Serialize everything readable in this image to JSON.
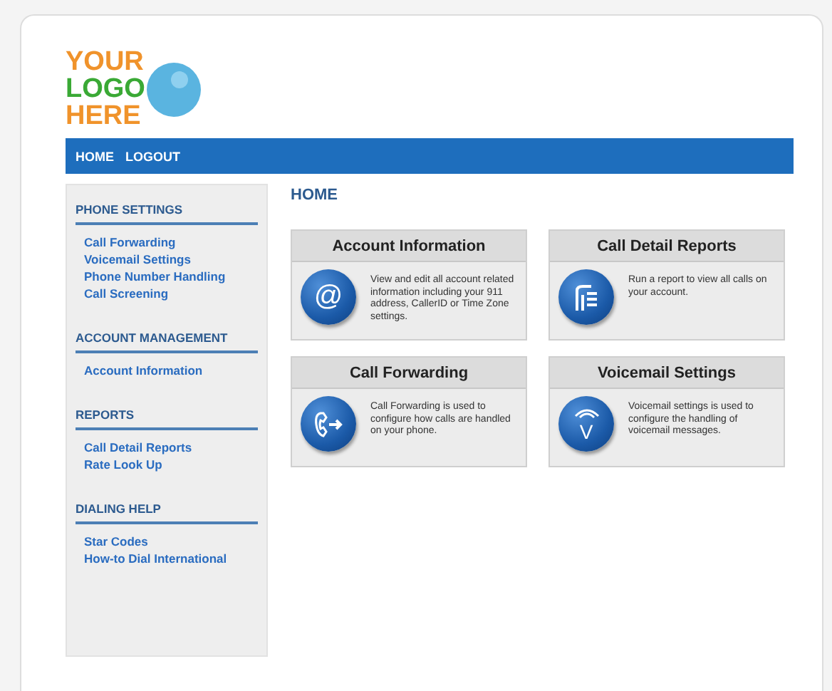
{
  "logo": {
    "lines": [
      "YOUR",
      "LOGO",
      "HERE"
    ]
  },
  "nav": [
    {
      "label": "HOME"
    },
    {
      "label": "LOGOUT"
    }
  ],
  "sidebar": [
    {
      "heading": "PHONE SETTINGS",
      "links": [
        "Call Forwarding",
        "Voicemail Settings",
        "Phone Number Handling",
        "Call Screening"
      ]
    },
    {
      "heading": "ACCOUNT MANAGEMENT",
      "links": [
        "Account Information"
      ]
    },
    {
      "heading": "REPORTS",
      "links": [
        "Call Detail Reports",
        "Rate Look Up"
      ]
    },
    {
      "heading": "DIALING HELP",
      "links": [
        "Star Codes",
        "How-to Dial International"
      ]
    }
  ],
  "page_title": "HOME",
  "cards": [
    {
      "title": "Account Information",
      "kind": "glyph",
      "glyph": "@",
      "text": "View and edit all account related information including your 911 address, CallerID or Time Zone settings."
    },
    {
      "title": "Call Detail Reports",
      "kind": "report",
      "text": "Run a report to view all calls on your account."
    },
    {
      "title": "Call Forwarding",
      "kind": "forward",
      "text": "Call Forwarding is used to configure how calls are handled on your phone."
    },
    {
      "title": "Voicemail Settings",
      "kind": "voicemail",
      "glyph": "V",
      "text": "Voicemail settings is used to configure the handling of voicemail messages."
    }
  ]
}
